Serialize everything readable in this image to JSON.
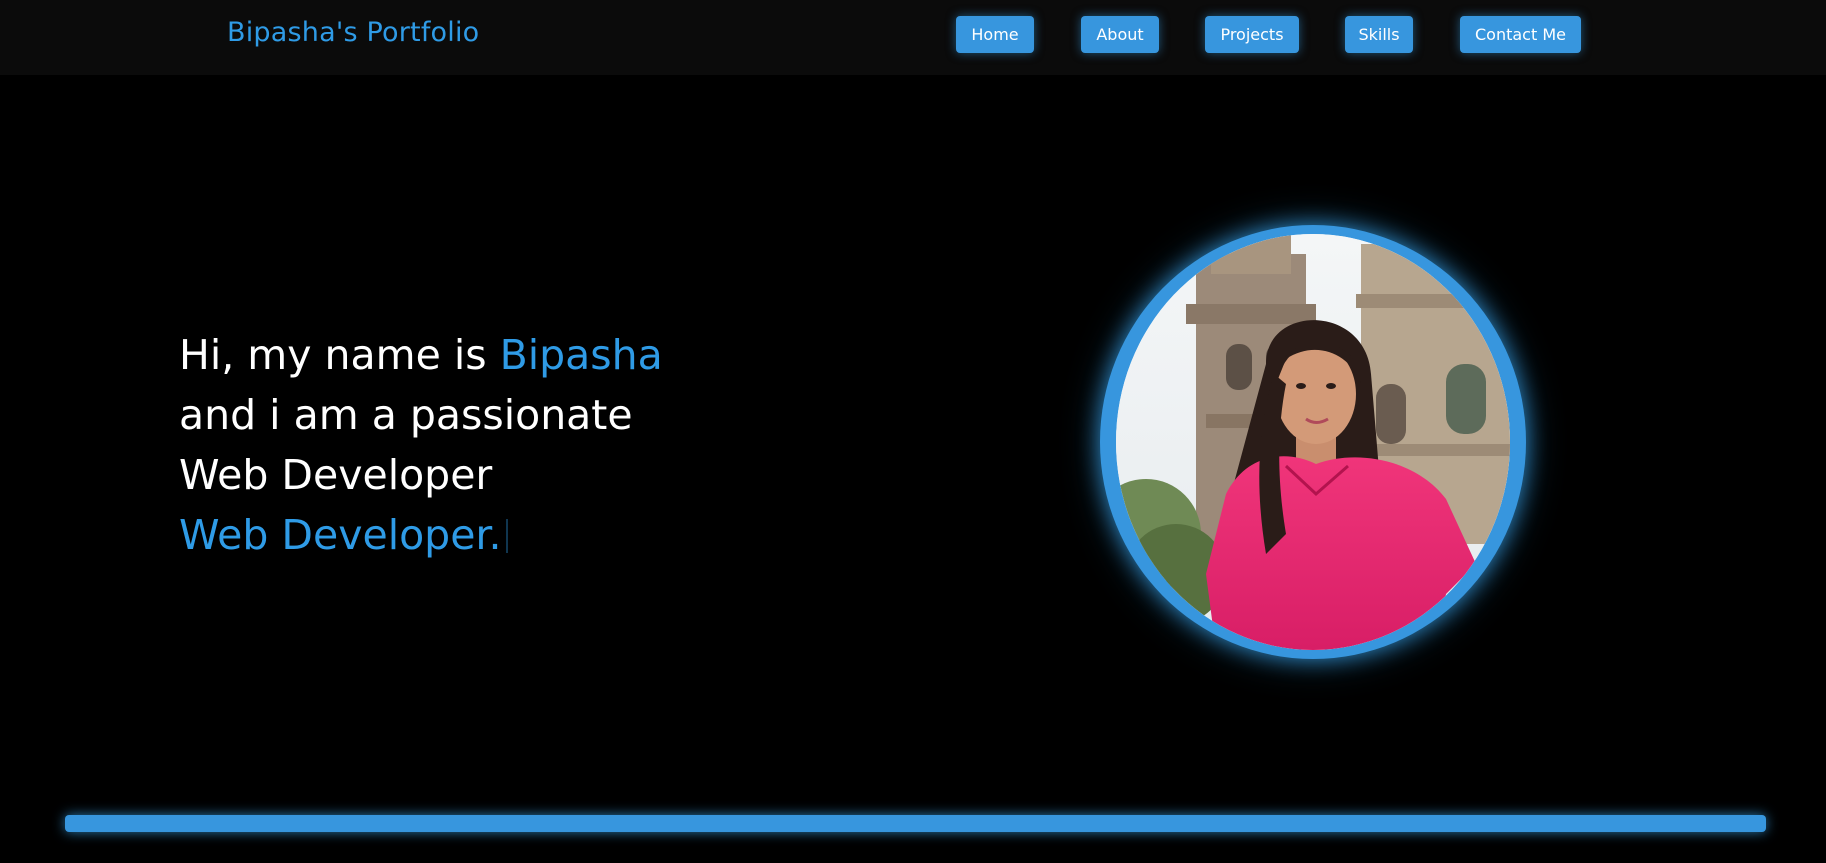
{
  "header": {
    "logo": "Bipasha's Portfolio",
    "nav": [
      {
        "label": "Home"
      },
      {
        "label": "About"
      },
      {
        "label": "Projects"
      },
      {
        "label": "Skills"
      },
      {
        "label": "Contact Me"
      }
    ]
  },
  "hero": {
    "intro_prefix": "Hi, my name is ",
    "name": "Bipasha",
    "line2": "and i am a passionate",
    "line3": "Web Developer",
    "typed": "Web Developer."
  },
  "colors": {
    "accent": "#3498db",
    "background": "#000000",
    "navbar": "#0b0b0b"
  },
  "icons": {
    "portrait": "profile-photo"
  }
}
